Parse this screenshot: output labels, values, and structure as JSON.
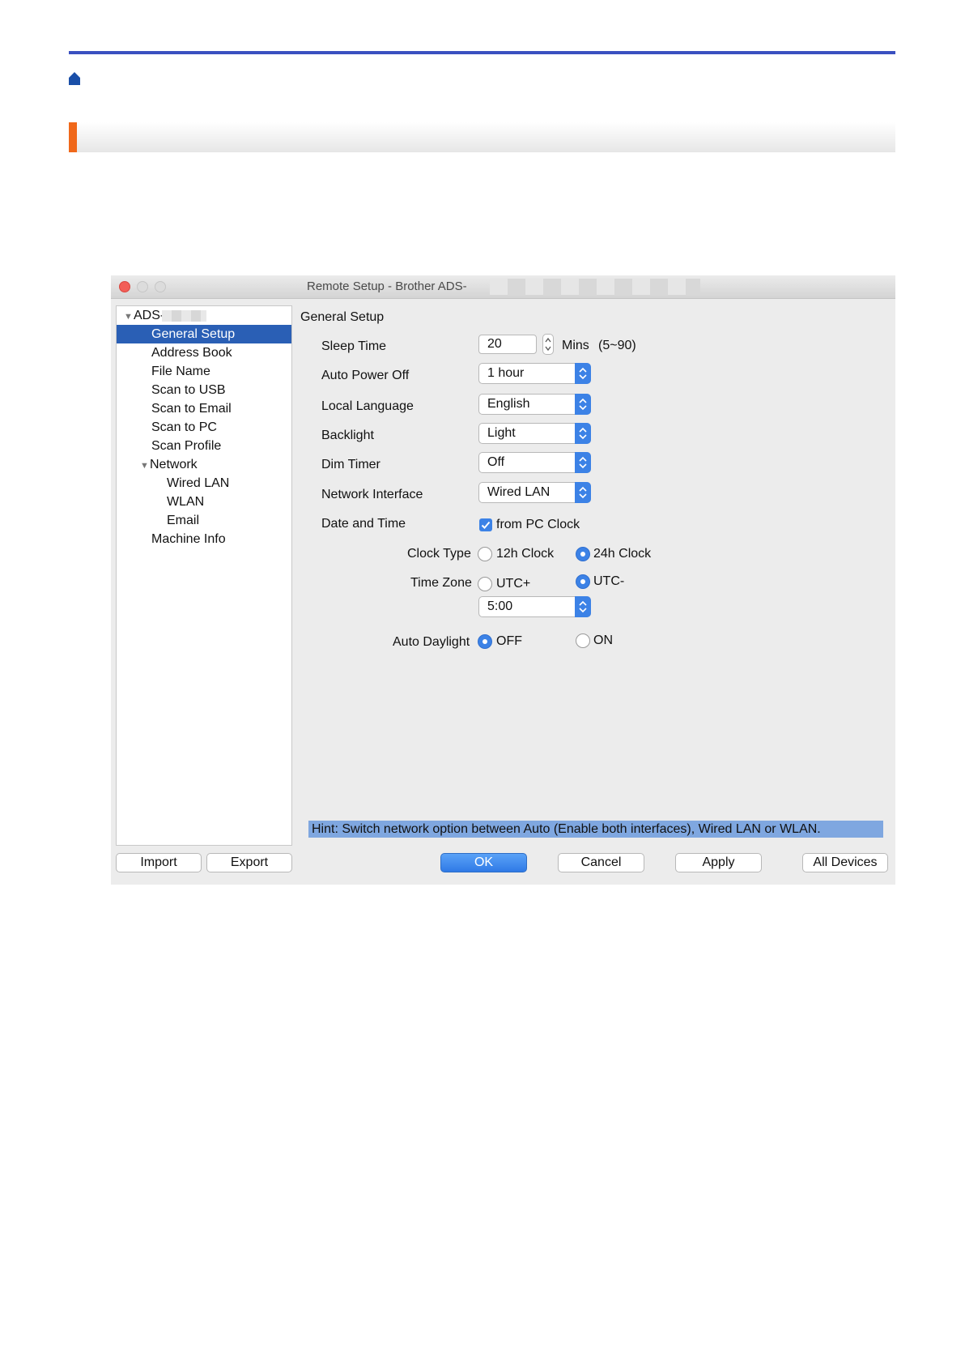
{
  "window": {
    "title": "Remote Setup - Brother ADS-",
    "colors": {
      "close": "#f25e57",
      "selection": "#2a5fb5",
      "accent": "#3c82e6",
      "hint_bg": "#7fa7e0"
    }
  },
  "sidebar": {
    "root": "ADS-",
    "items": [
      {
        "label": "General Setup"
      },
      {
        "label": "Address Book"
      },
      {
        "label": "File Name"
      },
      {
        "label": "Scan to USB"
      },
      {
        "label": "Scan to Email"
      },
      {
        "label": "Scan to PC"
      },
      {
        "label": "Scan Profile"
      },
      {
        "label": "Network"
      },
      {
        "label": "Wired LAN"
      },
      {
        "label": "WLAN"
      },
      {
        "label": "Email"
      },
      {
        "label": "Machine Info"
      }
    ]
  },
  "panel": {
    "heading": "General Setup",
    "sleep_time": {
      "label": "Sleep Time",
      "value": "20",
      "unit": "Mins",
      "range": "(5~90)"
    },
    "auto_power_off": {
      "label": "Auto Power Off",
      "value": "1 hour"
    },
    "local_language": {
      "label": "Local Language",
      "value": "English"
    },
    "backlight": {
      "label": "Backlight",
      "value": "Light"
    },
    "dim_timer": {
      "label": "Dim Timer",
      "value": "Off"
    },
    "network_interface": {
      "label": "Network Interface",
      "value": "Wired LAN"
    },
    "date_time": {
      "label": "Date and Time",
      "checkbox_label": "from PC Clock",
      "checked": true
    },
    "clock_type": {
      "label": "Clock Type",
      "option_12h": "12h Clock",
      "option_24h": "24h Clock",
      "selected": "24h Clock"
    },
    "time_zone": {
      "label": "Time Zone",
      "option_plus": "UTC+",
      "option_minus": "UTC-",
      "selected": "UTC-",
      "offset": "5:00"
    },
    "auto_daylight": {
      "label": "Auto Daylight",
      "option_off": "OFF",
      "option_on": "ON",
      "selected": "OFF"
    },
    "hint": "Hint: Switch network option between Auto (Enable both interfaces), Wired LAN or WLAN."
  },
  "buttons": {
    "import": "Import",
    "export": "Export",
    "ok": "OK",
    "cancel": "Cancel",
    "apply": "Apply",
    "all_devices": "All Devices"
  }
}
